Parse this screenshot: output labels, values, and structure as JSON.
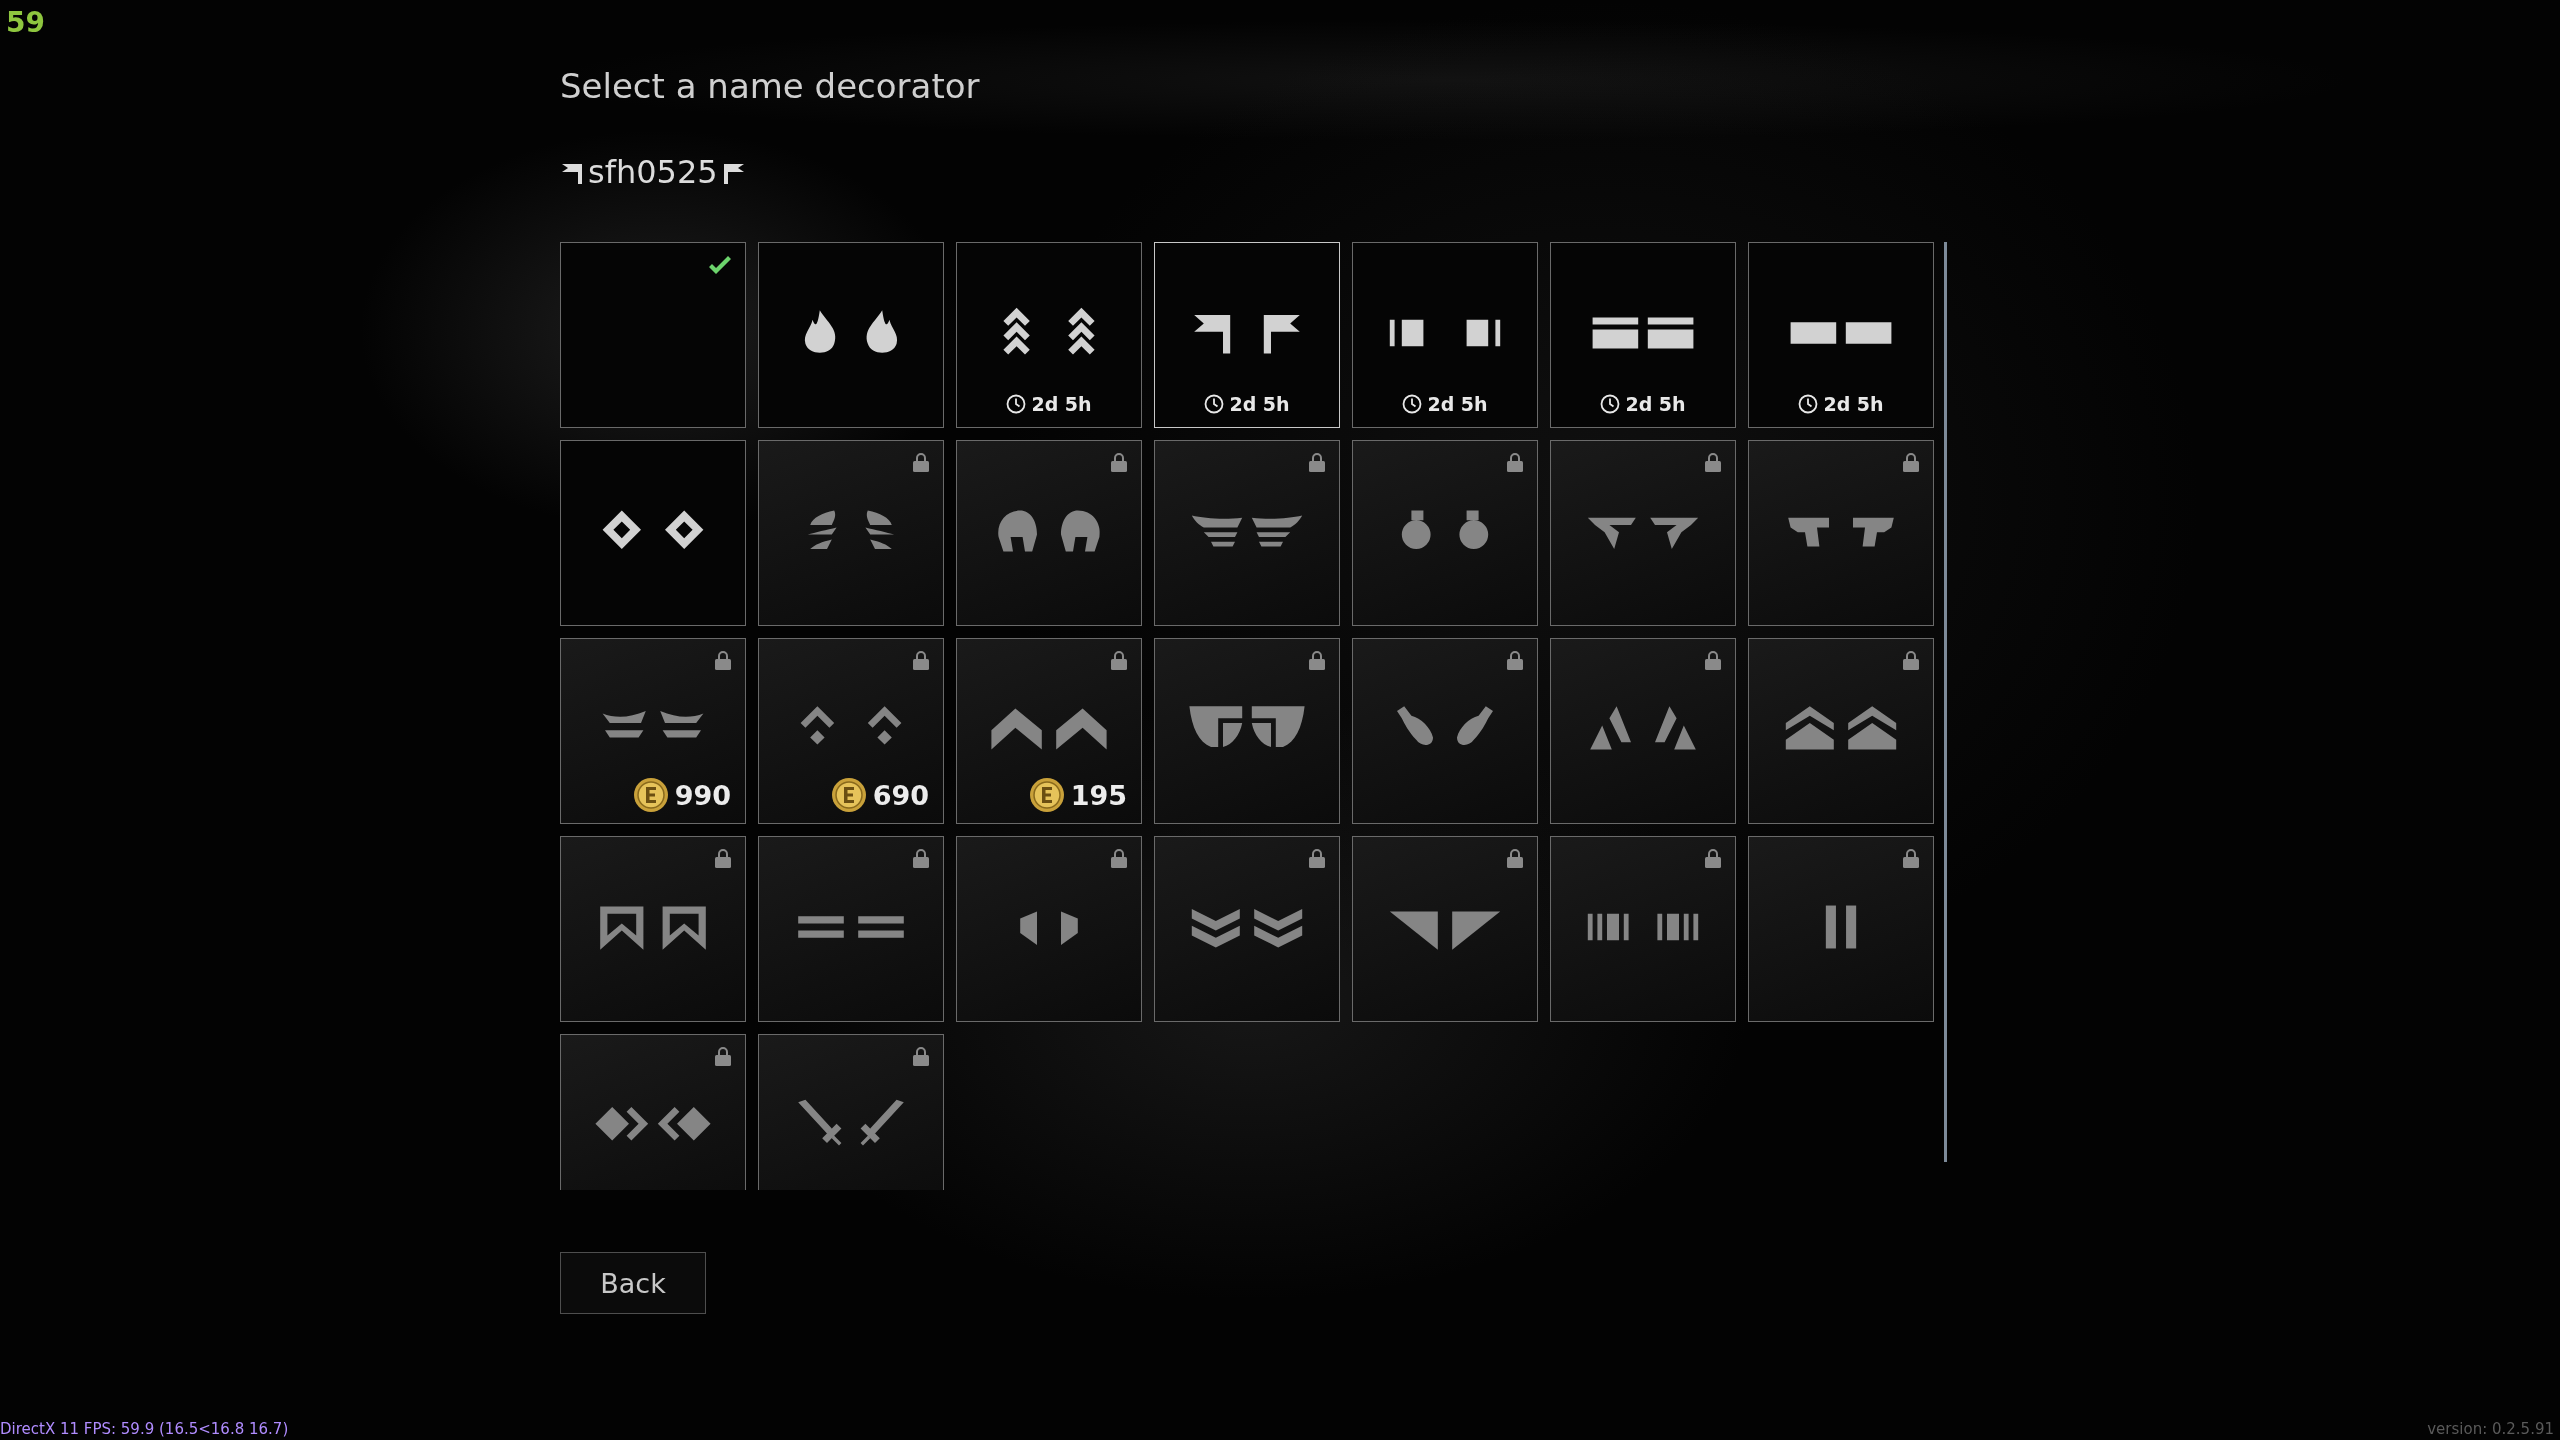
{
  "fps_counter": "59",
  "title": "Select a name decorator",
  "player_name": "sfh0525",
  "decorators": [
    {
      "selected": true,
      "locked": false,
      "hovered": false
    },
    {
      "selected": false,
      "locked": false,
      "hovered": false
    },
    {
      "selected": false,
      "locked": false,
      "hovered": false,
      "timer": "2d 5h"
    },
    {
      "selected": false,
      "locked": false,
      "hovered": true,
      "timer": "2d 5h"
    },
    {
      "selected": false,
      "locked": false,
      "hovered": false,
      "timer": "2d 5h"
    },
    {
      "selected": false,
      "locked": false,
      "hovered": false,
      "timer": "2d 5h"
    },
    {
      "selected": false,
      "locked": false,
      "hovered": false,
      "timer": "2d 5h"
    },
    {
      "selected": false,
      "locked": false,
      "hovered": false
    },
    {
      "selected": false,
      "locked": true,
      "hovered": false
    },
    {
      "selected": false,
      "locked": true,
      "hovered": false
    },
    {
      "selected": false,
      "locked": true,
      "hovered": false
    },
    {
      "selected": false,
      "locked": true,
      "hovered": false
    },
    {
      "selected": false,
      "locked": true,
      "hovered": false
    },
    {
      "selected": false,
      "locked": true,
      "hovered": false
    },
    {
      "selected": false,
      "locked": true,
      "hovered": false,
      "price": "990"
    },
    {
      "selected": false,
      "locked": true,
      "hovered": false,
      "price": "690"
    },
    {
      "selected": false,
      "locked": true,
      "hovered": false,
      "price": "195"
    },
    {
      "selected": false,
      "locked": true,
      "hovered": false
    },
    {
      "selected": false,
      "locked": true,
      "hovered": false
    },
    {
      "selected": false,
      "locked": true,
      "hovered": false
    },
    {
      "selected": false,
      "locked": true,
      "hovered": false
    },
    {
      "selected": false,
      "locked": true,
      "hovered": false
    },
    {
      "selected": false,
      "locked": true,
      "hovered": false
    },
    {
      "selected": false,
      "locked": true,
      "hovered": false
    },
    {
      "selected": false,
      "locked": true,
      "hovered": false
    },
    {
      "selected": false,
      "locked": true,
      "hovered": false
    },
    {
      "selected": false,
      "locked": true,
      "hovered": false
    },
    {
      "selected": false,
      "locked": true,
      "hovered": false
    },
    {
      "selected": false,
      "locked": true,
      "hovered": false
    },
    {
      "selected": false,
      "locked": true,
      "hovered": false
    }
  ],
  "back_button": "Back",
  "debug_info": "DirectX 11 FPS: 59.9 (16.5<16.8 16.7)",
  "version": "version: 0.2.5.91"
}
